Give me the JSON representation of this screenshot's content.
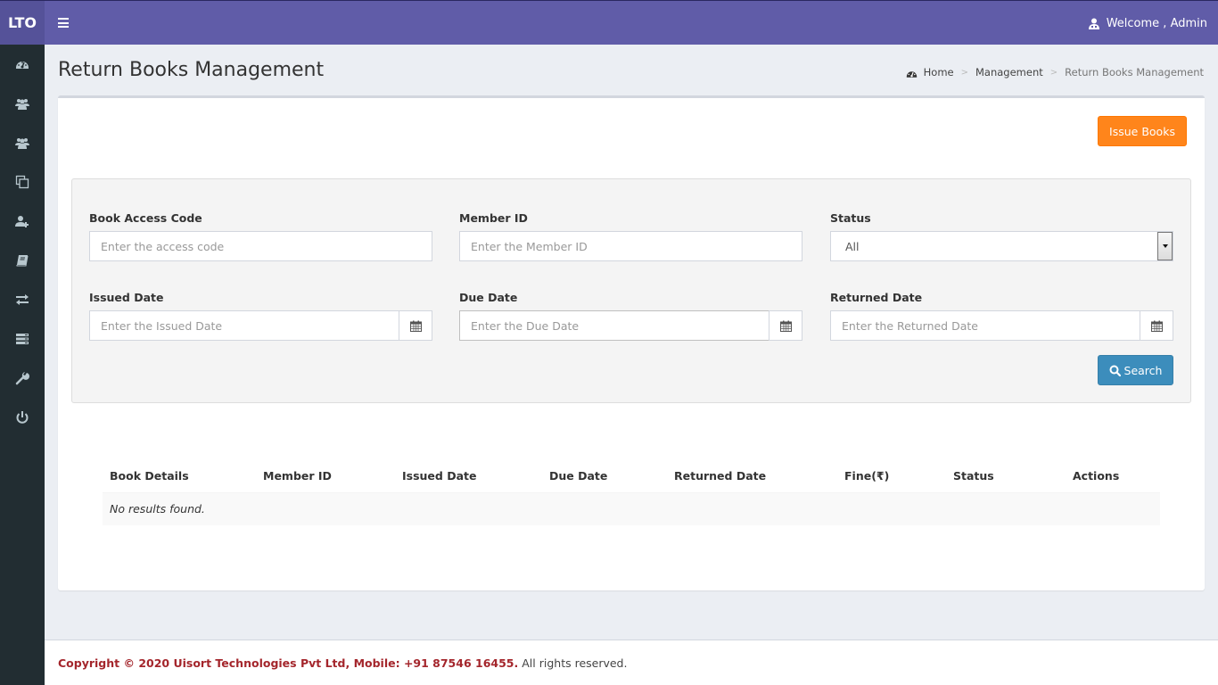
{
  "app": {
    "logo": "LTO",
    "welcome": "Welcome , Admin"
  },
  "sidebar": {
    "items": [
      {
        "icon": "dashboard-icon"
      },
      {
        "icon": "users-icon"
      },
      {
        "icon": "members-icon"
      },
      {
        "icon": "copy-icon"
      },
      {
        "icon": "user-plus-icon"
      },
      {
        "icon": "book-icon"
      },
      {
        "icon": "exchange-icon"
      },
      {
        "icon": "list-icon"
      },
      {
        "icon": "wrench-icon"
      },
      {
        "icon": "power-icon"
      }
    ]
  },
  "header": {
    "title": "Return Books Management",
    "breadcrumb": [
      "Home",
      "Management",
      "Return Books Management"
    ]
  },
  "actions": {
    "issue_books": "Issue Books",
    "search": "Search"
  },
  "filters": {
    "book_access_code": {
      "label": "Book Access Code",
      "placeholder": "Enter the access code",
      "value": ""
    },
    "member_id": {
      "label": "Member ID",
      "placeholder": "Enter the Member ID",
      "value": ""
    },
    "status": {
      "label": "Status",
      "selected": "All"
    },
    "issued_date": {
      "label": "Issued Date",
      "placeholder": "Enter the Issued Date",
      "value": ""
    },
    "due_date": {
      "label": "Due Date",
      "placeholder": "Enter the Due Date",
      "value": ""
    },
    "returned_date": {
      "label": "Returned Date",
      "placeholder": "Enter the Returned Date",
      "value": ""
    }
  },
  "table": {
    "columns": [
      "Book Details",
      "Member ID",
      "Issued Date",
      "Due Date",
      "Returned Date",
      "Fine(₹)",
      "Status",
      "Actions"
    ],
    "empty_message": "No results found."
  },
  "footer": {
    "copyright": "Copyright © 2020 Uisort Technologies Pvt Ltd, Mobile: +91 87546 16455.",
    "rights": "All rights reserved."
  },
  "colors": {
    "topbar": "#605ca8",
    "sidebar": "#222d32",
    "issue_button": "#ff851b",
    "search_button": "#3c8dbc",
    "footer_brand": "#a4262c"
  }
}
